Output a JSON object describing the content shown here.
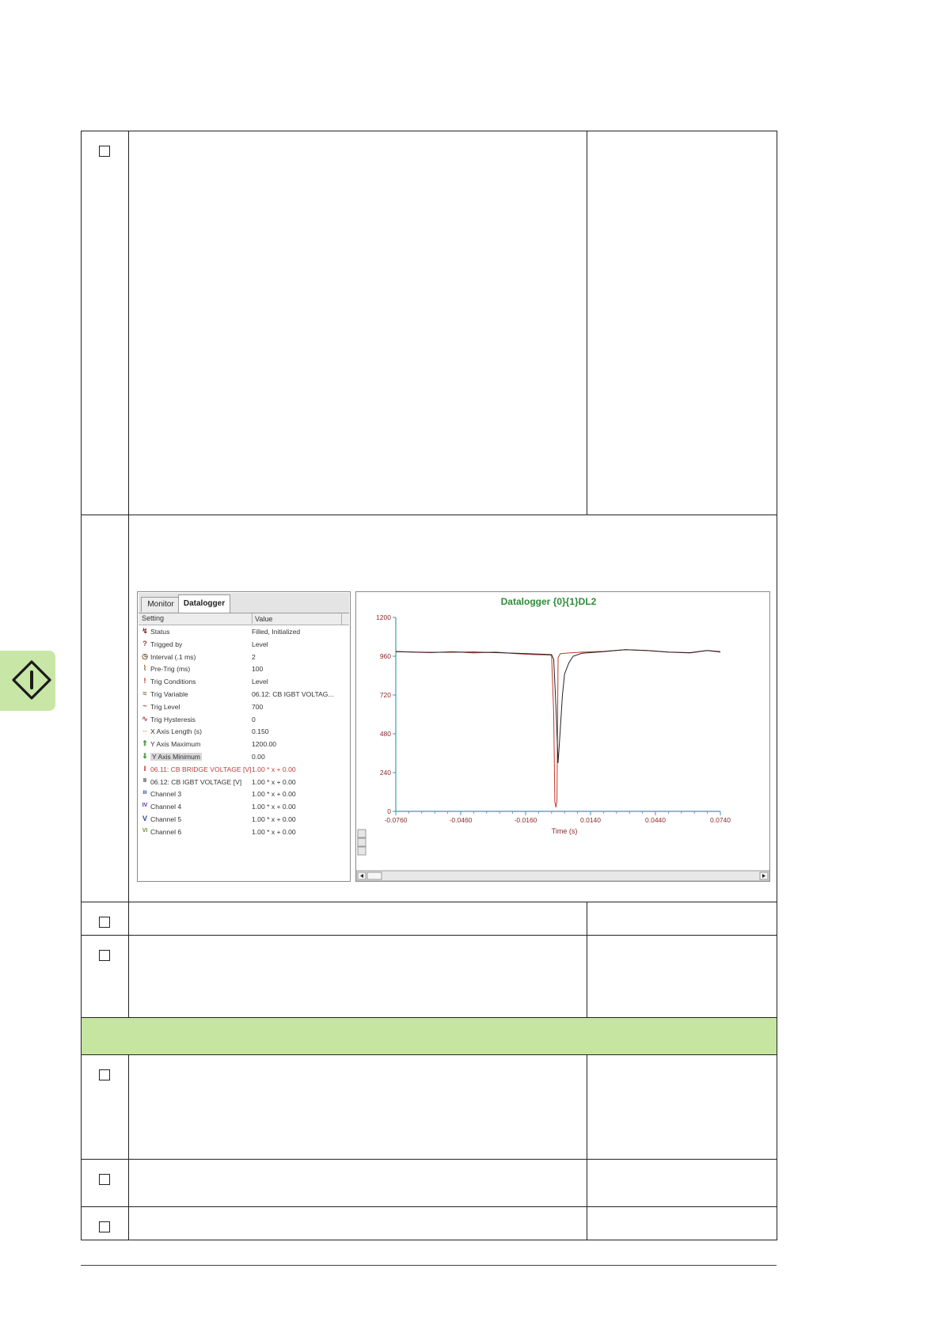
{
  "datalogger": {
    "tabs": [
      "Monitor",
      "Datalogger"
    ],
    "columns": {
      "setting": "Setting",
      "value": "Value"
    },
    "rows": [
      {
        "icon": "status-icon",
        "glyph": "↯",
        "color": "#8b2a2a",
        "setting": "Status",
        "value": "Filled, Initialized"
      },
      {
        "icon": "trigger-icon",
        "glyph": "?",
        "color": "#b03030",
        "setting": "Trigged by",
        "value": "Level"
      },
      {
        "icon": "clock-icon",
        "glyph": "◷",
        "color": "#6b4a2a",
        "setting": "Interval (.1 ms)",
        "value": "2"
      },
      {
        "icon": "pretrig-icon",
        "glyph": "⌇",
        "color": "#a06030",
        "setting": "Pre-Trig (ms)",
        "value": "100"
      },
      {
        "icon": "exclamation-icon",
        "glyph": "!",
        "color": "#c02020",
        "setting": "Trig Conditions",
        "value": "Level"
      },
      {
        "icon": "variable-icon",
        "glyph": "≈",
        "color": "#8a5a2a",
        "setting": "Trig Variable",
        "value": "06.12: CB IGBT VOLTAG..."
      },
      {
        "icon": "level-icon",
        "glyph": "~",
        "color": "#b04040",
        "setting": "Trig Level",
        "value": "700"
      },
      {
        "icon": "hysteresis-icon",
        "glyph": "∿",
        "color": "#b04040",
        "setting": "Trig Hysteresis",
        "value": "0"
      },
      {
        "icon": "x-axis-icon",
        "glyph": "⇔",
        "color": "#c08020",
        "setting": "X Axis Length (s)",
        "value": "0.150"
      },
      {
        "icon": "arrow-up-icon",
        "glyph": "⇑",
        "color": "#2a8a2a",
        "setting": "Y Axis Maximum",
        "value": "1200.00"
      },
      {
        "icon": "arrow-down-icon",
        "glyph": "⇓",
        "color": "#2a8a2a",
        "setting": "Y Axis Minimum",
        "value": "0.00"
      },
      {
        "icon": "channel-1-icon",
        "glyph": "I",
        "color": "#c02020",
        "setting": "06.11: CB BRIDGE VOLTAGE [V]",
        "value": "1.00 * x + 0.00"
      },
      {
        "icon": "channel-2-icon",
        "glyph": "II",
        "color": "#222222",
        "setting": "06.12: CB IGBT VOLTAGE [V]",
        "value": "1.00 * x + 0.00"
      },
      {
        "icon": "channel-3-icon",
        "glyph": "III",
        "color": "#2a4aa0",
        "setting": "Channel 3",
        "value": "1.00 * x + 0.00"
      },
      {
        "icon": "channel-4-icon",
        "glyph": "IV",
        "color": "#5a2aa0",
        "setting": "Channel 4",
        "value": "1.00 * x + 0.00"
      },
      {
        "icon": "channel-5-icon",
        "glyph": "V",
        "color": "#2a4aa0",
        "setting": "Channel 5",
        "value": "1.00 * x + 0.00"
      },
      {
        "icon": "channel-6-icon",
        "glyph": "VI",
        "color": "#6a8a2a",
        "setting": "Channel 6",
        "value": "1.00 * x + 0.00"
      }
    ]
  },
  "chart_data": {
    "type": "line",
    "title": "Datalogger {0}{1}DL2",
    "xlabel": "Time (s)",
    "ylabel": "",
    "xlim": [
      -0.076,
      0.074
    ],
    "ylim": [
      0,
      1200
    ],
    "xticks": [
      "-0.0760",
      "-0.0460",
      "-0.0160",
      "0.0140",
      "0.0440",
      "0.0740"
    ],
    "yticks": [
      "0",
      "240",
      "480",
      "720",
      "960",
      "1200"
    ],
    "grid": false,
    "legend": "none",
    "series": [
      {
        "color": "#c0392b",
        "x": [
          -0.076,
          -0.068,
          -0.06,
          -0.05,
          -0.04,
          -0.03,
          -0.02,
          -0.012,
          -0.006,
          -0.004,
          -0.003,
          -0.0025,
          -0.002,
          -0.0015,
          -0.001,
          0,
          0.004,
          0.01,
          0.02,
          0.03,
          0.04,
          0.05,
          0.06,
          0.068,
          0.074
        ],
        "values": [
          990,
          985,
          982,
          988,
          980,
          986,
          975,
          970,
          968,
          966,
          600,
          60,
          25,
          70,
          950,
          975,
          980,
          985,
          990,
          1000,
          995,
          985,
          980,
          995,
          985
        ]
      },
      {
        "color": "#222222",
        "x": [
          -0.076,
          -0.06,
          -0.04,
          -0.02,
          -0.008,
          -0.004,
          -0.003,
          -0.002,
          -0.001,
          0,
          0.001,
          0.002,
          0.004,
          0.006,
          0.01,
          0.02,
          0.03,
          0.04,
          0.05,
          0.06,
          0.068,
          0.074
        ],
        "values": [
          988,
          984,
          986,
          978,
          972,
          970,
          940,
          650,
          300,
          500,
          720,
          850,
          920,
          960,
          978,
          988,
          1000,
          996,
          986,
          982,
          996,
          988
        ]
      }
    ]
  }
}
